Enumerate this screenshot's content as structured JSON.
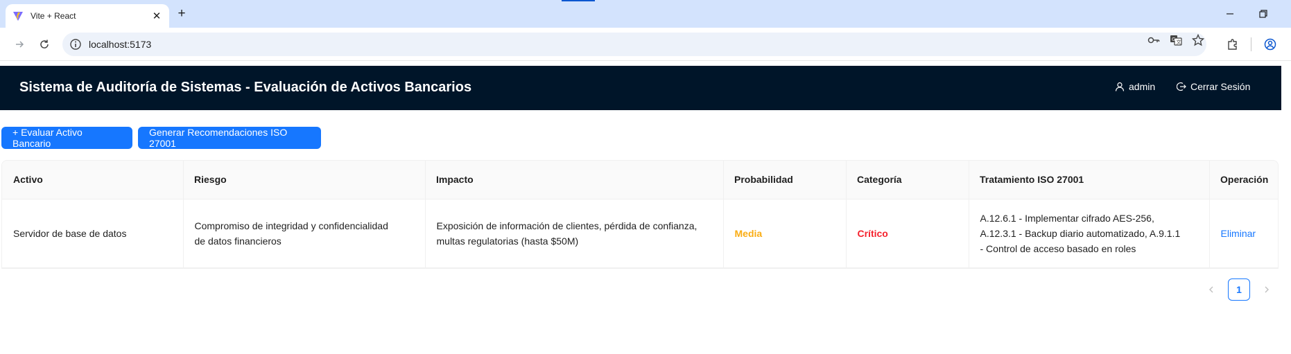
{
  "browser": {
    "tab_title": "Vite + React",
    "url": "localhost:5173"
  },
  "app": {
    "title": "Sistema de Auditoría de Sistemas - Evaluación de Activos Bancarios",
    "user": "admin",
    "logout": "Cerrar Sesión"
  },
  "actions": {
    "evaluate": "+ Evaluar Activo Bancario",
    "recommend": "Generar Recomendaciones ISO 27001"
  },
  "table": {
    "columns": [
      "Activo",
      "Riesgo",
      "Impacto",
      "Probabilidad",
      "Categoría",
      "Tratamiento ISO 27001",
      "Operación"
    ],
    "rows": [
      {
        "activo": "Servidor de base de datos",
        "riesgo": [
          "Compromiso de integridad y confidencialidad",
          "de datos financieros"
        ],
        "impacto": [
          "Exposición de información de clientes, pérdida de confianza,",
          "multas regulatorias (hasta $50M)"
        ],
        "probabilidad": "Media",
        "categoria": "Crítico",
        "tratamiento": [
          "A.12.6.1 - Implementar cifrado AES-256,",
          "A.12.3.1 - Backup diario automatizado, A.9.1.1",
          "- Control de acceso basado en roles"
        ],
        "operacion": "Eliminar"
      }
    ]
  },
  "pagination": {
    "current_page": "1"
  },
  "colors": {
    "header_bg": "#001529",
    "primary": "#1677ff",
    "prob_media": "#faad14",
    "cat_critico": "#f5222d"
  }
}
